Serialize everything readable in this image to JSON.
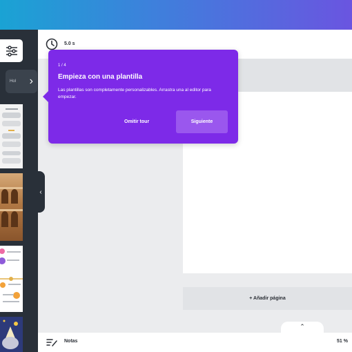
{
  "header": {
    "duration": "5.0 s"
  },
  "sidebar": {
    "pill_label": "Hol",
    "pill_chevron": "›",
    "collapse_chevron": "‹",
    "icons": [
      "filters-icon",
      "chevron-right-icon",
      "chevron-left-icon"
    ]
  },
  "tour": {
    "step": "1 / 4",
    "title": "Empieza con una plantilla",
    "description": "Las plantillas son completamente personalizables. Arrastra una al editor para empezar.",
    "skip_label": "Omitir tour",
    "next_label": "Siguiente"
  },
  "canvas": {
    "add_page_label": "+ Añadir página",
    "expand_chevron": "⌃"
  },
  "footer": {
    "notes_label": "Notas",
    "zoom": "51 %"
  },
  "colors": {
    "topbar_gradient": [
      "#1aa3d4",
      "#6a55e0"
    ],
    "sidebar": "#293039",
    "tour_background": "#7d2ae8",
    "tour_button": "#9a57ee"
  }
}
